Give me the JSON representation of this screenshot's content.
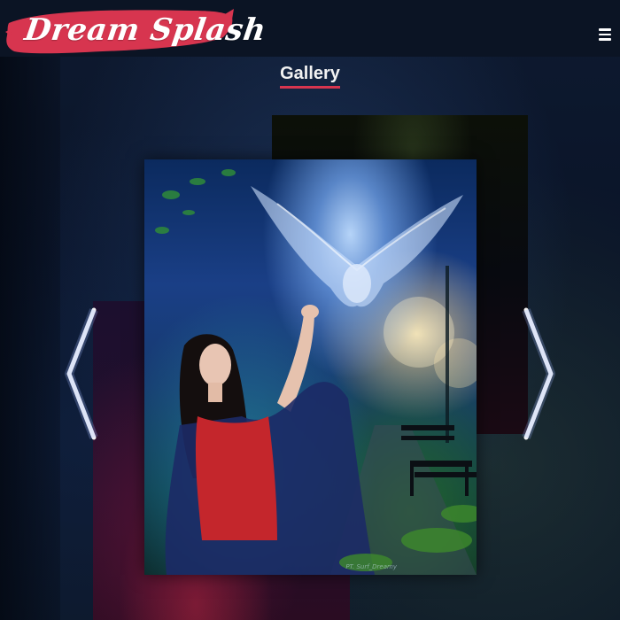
{
  "header": {
    "logo_text": "Dream Splash",
    "brand_color": "#d7354f",
    "menu_icon": "hamburger-menu-icon"
  },
  "gallery": {
    "title": "Gallery",
    "prev_icon": "chevron-left-icon",
    "next_icon": "chevron-right-icon",
    "main_image_watermark": "PT. Surf_Dreamy",
    "slides": [
      {
        "name": "owl-girl-night-park"
      },
      {
        "name": "dark-forest-red"
      },
      {
        "name": "purple-night-red"
      }
    ]
  },
  "colors": {
    "header_bg": "#0b1424",
    "underline": "#d7354f",
    "title_text": "#f2f2f2"
  }
}
